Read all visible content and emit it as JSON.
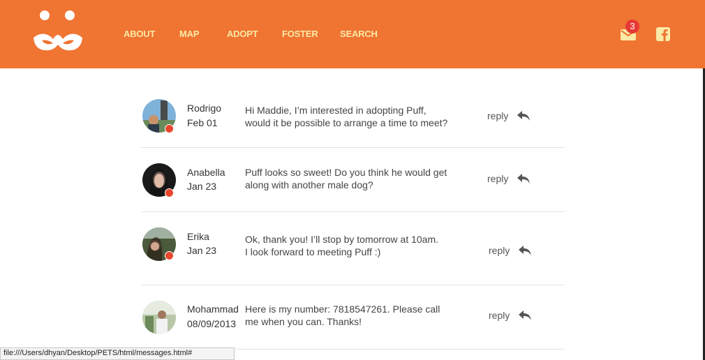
{
  "brand": {
    "accent": "#f07432",
    "nav_text": "#fbe9a6",
    "unread_dot": "#e9462e"
  },
  "nav": {
    "about": "ABOUT",
    "map": "MAP",
    "adopt": "ADOPT",
    "foster": "FOSTER",
    "search": "SEARCH"
  },
  "header_icons": {
    "mail_icon": "mail-icon",
    "mail_badge": "3",
    "facebook_icon": "facebook-icon"
  },
  "messages": [
    {
      "sender": "Rodrigo",
      "date": "Feb 01",
      "line1": "Hi Maddie, I’m interested in adopting Puff,",
      "line2": "would it be possible to arrange a time to meet?",
      "reply": "reply",
      "unread": true
    },
    {
      "sender": "Anabella",
      "date": "Jan 23",
      "line1": "Puff looks so sweet! Do you think he would get",
      "line2": "along with another male dog?",
      "reply": "reply",
      "unread": true
    },
    {
      "sender": "Erika",
      "date": "Jan 23",
      "line1": "Ok, thank you! I’ll stop by tomorrow at 10am.",
      "line2": "I look forward to meeting Puff :)",
      "reply": "reply",
      "unread": true
    },
    {
      "sender": "Mohammad",
      "date": "08/09/2013",
      "line1": "Here is my number: 7818547261. Please call",
      "line2": "me when you can. Thanks!",
      "reply": "reply",
      "unread": false
    }
  ],
  "statusbar": {
    "url": "file:///Users/dhyan/Desktop/PETS/html/messages.html#"
  }
}
